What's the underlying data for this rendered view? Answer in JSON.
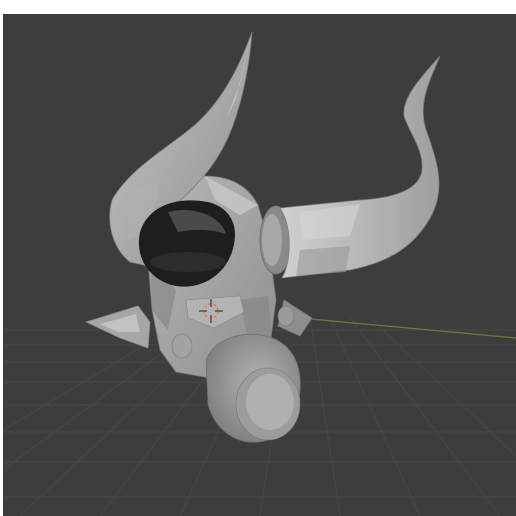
{
  "viewport": {
    "background": "#3d3d3d",
    "grid_line_color": "#474747",
    "horizon_axis_color": "#6b7a3a",
    "model_base_color": "#9a9a9a",
    "model_highlight_color": "#c4c4c4",
    "model_shadow_color": "#6c6c6c",
    "eye_socket_color": "#1e1e1e",
    "cursor_color": "#e07a5f",
    "icons": [
      "3d-cursor-icon"
    ]
  }
}
